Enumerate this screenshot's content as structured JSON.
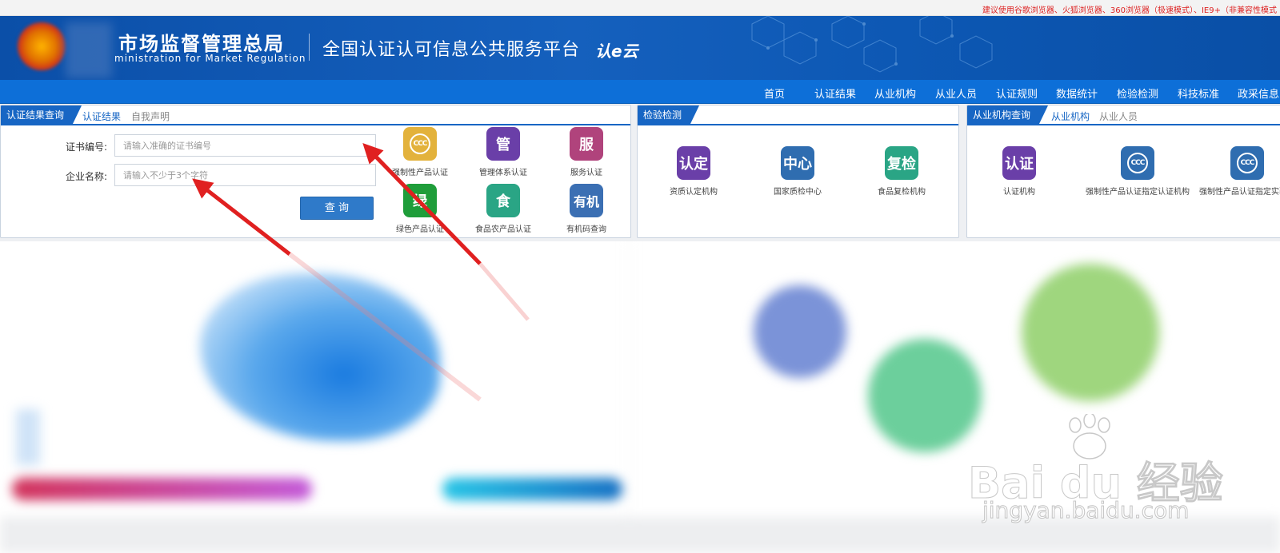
{
  "notice": "建议使用谷歌浏览器、火狐浏览器、360浏览器（极速模式）、IE9+（非兼容性模式",
  "header": {
    "admin_name": "市场监督管理总局",
    "admin_en": "ministration for Market Regulation",
    "platform_name": "全国认证认可信息公共服务平台",
    "cloud_logo": "认e云"
  },
  "nav": [
    "首页",
    "认证结果",
    "从业机构",
    "从业人员",
    "认证规则",
    "数据统计",
    "检验检测",
    "科技标准",
    "政采信息"
  ],
  "cert_panel": {
    "active_tab": "认证结果查询",
    "subtabs": [
      "认证结果",
      "自我声明"
    ],
    "cert_no_label": "证书编号:",
    "cert_no_placeholder": "请输入准确的证书编号",
    "company_label": "企业名称:",
    "company_placeholder": "请输入不少于3个字符",
    "query_button": "查 询",
    "tiles": [
      {
        "icon": "CCC",
        "label": "强制性产品认证",
        "color": "#e3b23c"
      },
      {
        "icon": "管",
        "label": "管理体系认证",
        "color": "#6a3fa8"
      },
      {
        "icon": "服",
        "label": "服务认证",
        "color": "#b0437c"
      },
      {
        "icon": "绿",
        "label": "绿色产品认证",
        "color": "#1f9d3a"
      },
      {
        "icon": "食",
        "label": "食品农产品认证",
        "color": "#2aa585"
      },
      {
        "icon": "有机",
        "label": "有机码查询",
        "color": "#3b6fb3"
      }
    ]
  },
  "inspect_panel": {
    "active_tab": "检验检测",
    "tiles": [
      {
        "icon": "认定",
        "label": "资质认定机构",
        "color": "#6a3fa8"
      },
      {
        "icon": "中心",
        "label": "国家质检中心",
        "color": "#2f6db0"
      },
      {
        "icon": "复检",
        "label": "食品复检机构",
        "color": "#2aa585"
      }
    ]
  },
  "org_panel": {
    "active_tab": "从业机构查询",
    "subtabs": [
      "从业机构",
      "从业人员"
    ],
    "tiles": [
      {
        "icon": "认证",
        "label": "认证机构",
        "color": "#6a3fa8"
      },
      {
        "icon": "CCC",
        "label": "强制性产品认证指定认证机构",
        "color": "#2f6db0"
      },
      {
        "icon": "CCC",
        "label": "强制性产品认证指定实验室",
        "color": "#2f6db0"
      }
    ]
  },
  "watermark": {
    "brand": "Bai  du 经验",
    "url": "jingyan.baidu.com"
  }
}
